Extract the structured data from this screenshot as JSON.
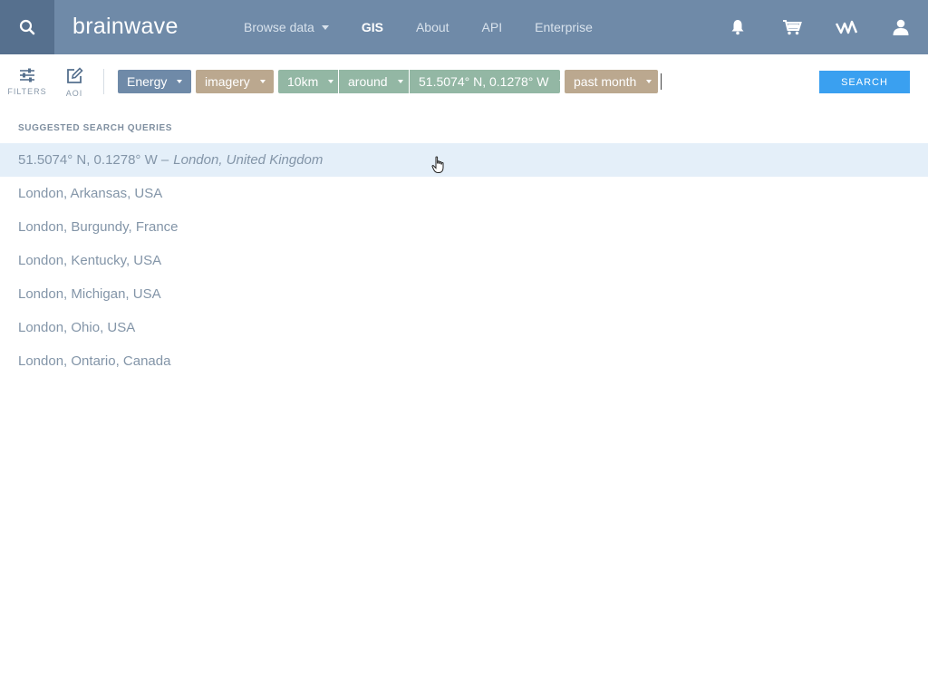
{
  "header": {
    "logo_text": "brainwave",
    "nav": [
      {
        "label": "Browse data",
        "has_dropdown": true
      },
      {
        "label": "GIS",
        "active": true
      },
      {
        "label": "About"
      },
      {
        "label": "API"
      },
      {
        "label": "Enterprise"
      }
    ],
    "icons": [
      "bell-icon",
      "cart-icon",
      "brand-mark-icon",
      "user-icon"
    ]
  },
  "toolbar": {
    "filters_label": "FILTERS",
    "aoi_label": "AOI",
    "chips": [
      {
        "label": "Energy",
        "color": "#6f8aa8"
      },
      {
        "label": "imagery",
        "color": "#bba88f"
      },
      {
        "label": "10km",
        "color": "#93b7a4"
      },
      {
        "label": "around",
        "color": "#93b7a4"
      },
      {
        "label": "51.5074° N, 0.1278° W",
        "color": "#93b7a4"
      },
      {
        "label": "past month",
        "color": "#bba88f"
      }
    ],
    "search_label": "SEARCH"
  },
  "suggestions": {
    "title": "SUGGESTED SEARCH QUERIES",
    "items": [
      {
        "main": "51.5074° N, 0.1278° W –",
        "sub": "London, United Kingdom",
        "hover": true
      },
      {
        "main": "London, Arkansas, USA"
      },
      {
        "main": "London, Burgundy, France"
      },
      {
        "main": "London, Kentucky, USA"
      },
      {
        "main": "London, Michigan, USA"
      },
      {
        "main": "London, Ohio, USA"
      },
      {
        "main": "London, Ontario, Canada"
      }
    ]
  },
  "colors": {
    "nav_bg": "#6f8aa8",
    "search_btn": "#3aa0f0",
    "hover_row": "#e4eff9"
  }
}
